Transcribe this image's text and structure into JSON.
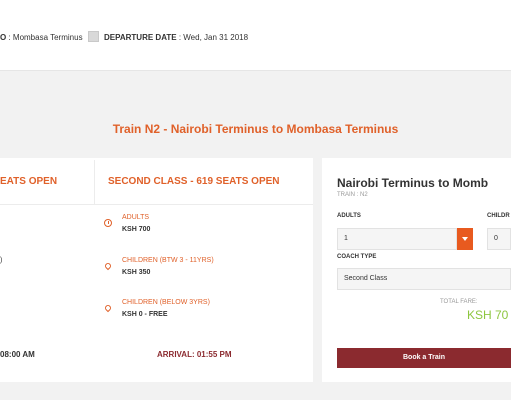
{
  "header": {
    "route_label": "O",
    "route_value": "Mombasa Terminus",
    "departure_label": "DEPARTURE DATE",
    "departure_value": "Wed, Jan 31 2018"
  },
  "train": {
    "title": "Train N2 - Nairobi Terminus to Mombasa Terminus"
  },
  "classes": {
    "first_header_partial": "EATS OPEN",
    "second_header": "SECOND CLASS - 619 SEATS OPEN",
    "fares": [
      {
        "label": "ADULTS",
        "value": "KSH 700"
      },
      {
        "label": "CHILDREN (BTW 3 - 11YRS)",
        "value": "KSH 350"
      },
      {
        "label": "CHILDREN (BELOW 3YRS)",
        "value": "KSH 0 - FREE"
      }
    ],
    "left_fragment": ")",
    "departure_partial": "08:00 AM",
    "arrival_label": "ARRIVAL:",
    "arrival_time": "01:55 PM"
  },
  "booking": {
    "title": "Nairobi Terminus to Momb",
    "train_label": "TRAIN : N2",
    "adults_label": "ADULTS",
    "adults_value": "1",
    "children_label": "CHILDR",
    "children_value": "0",
    "coach_label": "COACH TYPE",
    "coach_value": "Second Class",
    "total_label": "TOTAL FARE:",
    "total_value": "KSH 70",
    "book_label": "Book a Train"
  },
  "colors": {
    "accent_orange": "#e0612a",
    "book_button": "#8b2a2f",
    "total_green": "#8dc63f"
  }
}
